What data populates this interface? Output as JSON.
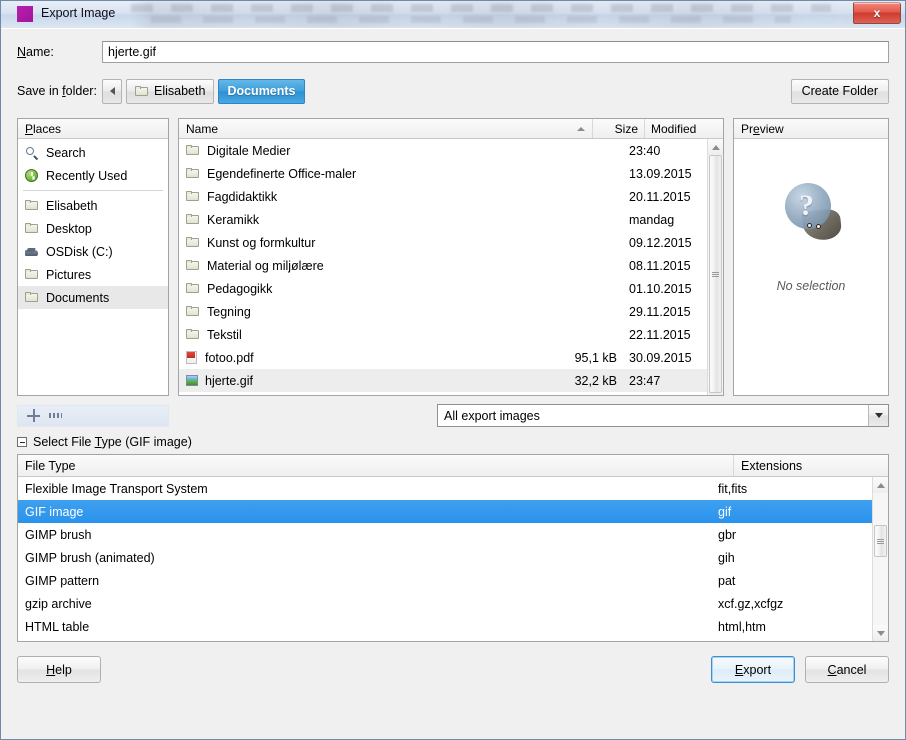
{
  "window": {
    "title": "Export Image",
    "close_label": "x",
    "app_icon": "gimp-icon",
    "accent_blue": "#2a93ec",
    "title_icon_color": "#b81fb0"
  },
  "name_field": {
    "label": "Name:",
    "label_mnemonic": "N",
    "value": "hjerte.gif",
    "placeholder": ""
  },
  "folder_bar": {
    "label": "Save in folder:",
    "label_mnemonic": "f",
    "back_icon": "chevron-left-icon",
    "crumbs": [
      {
        "label": "Elisabeth",
        "active": false,
        "icon": "folder-icon"
      },
      {
        "label": "Documents",
        "active": true,
        "icon": ""
      }
    ],
    "create_folder_label": "Create Folder"
  },
  "places": {
    "header": "Places",
    "header_mnemonic": "P",
    "items": [
      {
        "label": "Search",
        "icon": "search-icon",
        "selected": false
      },
      {
        "label": "Recently Used",
        "icon": "recent-clock-icon",
        "selected": false
      },
      {
        "label": "Elisabeth",
        "icon": "folder-icon",
        "selected": false
      },
      {
        "label": "Desktop",
        "icon": "folder-icon",
        "selected": false
      },
      {
        "label": "OSDisk (C:)",
        "icon": "drive-icon",
        "selected": false
      },
      {
        "label": "Pictures",
        "icon": "folder-icon",
        "selected": false
      },
      {
        "label": "Documents",
        "icon": "folder-icon",
        "selected": true
      }
    ],
    "separator_after_index": 1
  },
  "file_list": {
    "columns": {
      "name": "Name",
      "size": "Size",
      "modified": "Modified"
    },
    "sort_column": "Name",
    "sort_direction": "ascending",
    "rows": [
      {
        "name": "Digitale Medier",
        "size": "",
        "modified": "23:40",
        "icon": "folder-icon",
        "selected": false
      },
      {
        "name": "Egendefinerte Office-maler",
        "size": "",
        "modified": "13.09.2015",
        "icon": "folder-icon",
        "selected": false
      },
      {
        "name": "Fagdidaktikk",
        "size": "",
        "modified": "20.11.2015",
        "icon": "folder-icon",
        "selected": false
      },
      {
        "name": "Keramikk",
        "size": "",
        "modified": "mandag",
        "icon": "folder-icon",
        "selected": false
      },
      {
        "name": "Kunst og formkultur",
        "size": "",
        "modified": "09.12.2015",
        "icon": "folder-icon",
        "selected": false
      },
      {
        "name": "Material og miljølære",
        "size": "",
        "modified": "08.11.2015",
        "icon": "folder-icon",
        "selected": false
      },
      {
        "name": "Pedagogikk",
        "size": "",
        "modified": "01.10.2015",
        "icon": "folder-icon",
        "selected": false
      },
      {
        "name": "Tegning",
        "size": "",
        "modified": "29.11.2015",
        "icon": "folder-icon",
        "selected": false
      },
      {
        "name": "Tekstil",
        "size": "",
        "modified": "22.11.2015",
        "icon": "folder-icon",
        "selected": false
      },
      {
        "name": "fotoo.pdf",
        "size": "95,1 kB",
        "modified": "30.09.2015",
        "icon": "pdf-file-icon",
        "selected": false
      },
      {
        "name": "hjerte.gif",
        "size": "32,2 kB",
        "modified": "23:47",
        "icon": "image-file-icon",
        "selected": true
      }
    ]
  },
  "preview": {
    "header": "Preview",
    "header_mnemonic": "e",
    "message": "No selection",
    "icon": "wilber-question-icon"
  },
  "toolbar_mini": {
    "icons": [
      "move-icon",
      "handle-icon"
    ]
  },
  "filter": {
    "value": "All export images",
    "arrow_icon": "chevron-down-icon"
  },
  "file_type_section": {
    "expander_label": "Select File Type (GIF image)",
    "expander_mnemonic": "T",
    "expanded": true,
    "columns": {
      "type": "File Type",
      "extensions": "Extensions"
    },
    "rows": [
      {
        "type": "Flexible Image Transport System",
        "extensions": "fit,fits",
        "selected": false
      },
      {
        "type": "GIF image",
        "extensions": "gif",
        "selected": true
      },
      {
        "type": "GIMP brush",
        "extensions": "gbr",
        "selected": false
      },
      {
        "type": "GIMP brush (animated)",
        "extensions": "gih",
        "selected": false
      },
      {
        "type": "GIMP pattern",
        "extensions": "pat",
        "selected": false
      },
      {
        "type": "gzip archive",
        "extensions": "xcf.gz,xcfgz",
        "selected": false
      },
      {
        "type": "HTML table",
        "extensions": "html,htm",
        "selected": false
      }
    ]
  },
  "buttons": {
    "help": "Help",
    "help_mnemonic": "H",
    "export": "Export",
    "export_mnemonic": "E",
    "cancel": "Cancel",
    "cancel_mnemonic": "C"
  }
}
